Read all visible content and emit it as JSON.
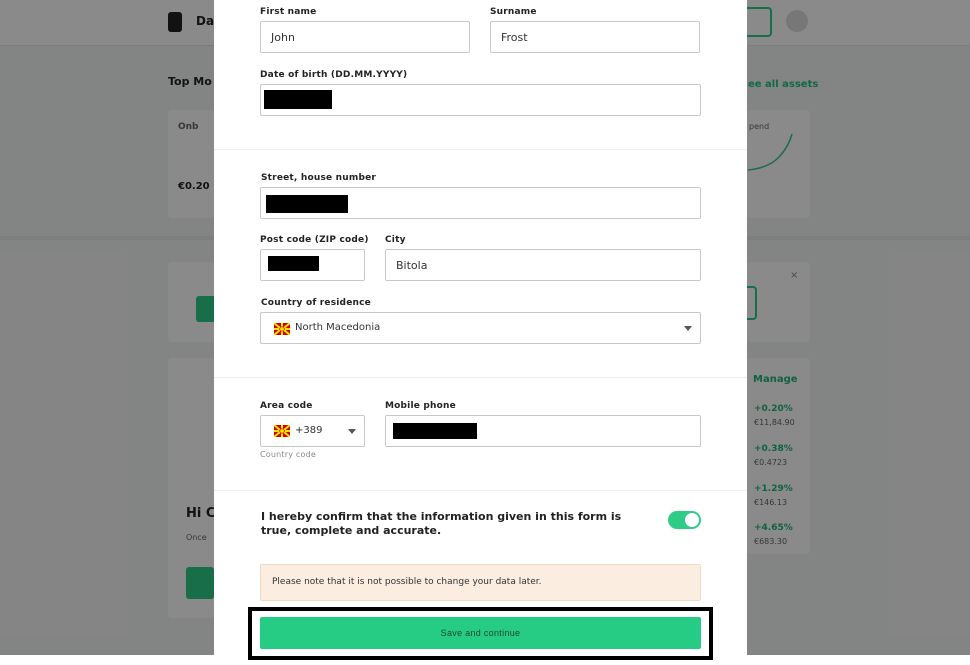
{
  "background": {
    "nav_text": "Das",
    "section_title": "Top Mo",
    "see_all_link": "ee all assets",
    "card_value": "€0.20",
    "card_label": "Onb",
    "spend_label": "pend",
    "manage_label": "Manage",
    "greeting": "Hi C",
    "greeting_sub": "Once",
    "movers": [
      {
        "change": "+0.20%",
        "price": "€11,84.90"
      },
      {
        "change": "+0.38%",
        "price": "€0.4723"
      },
      {
        "change": "+1.29%",
        "price": "€146.13"
      },
      {
        "change": "+4.65%",
        "price": "€683.30"
      }
    ]
  },
  "form": {
    "first_name": {
      "label": "First name",
      "value": "John"
    },
    "surname": {
      "label": "Surname",
      "value": "Frost"
    },
    "dob": {
      "label": "Date of birth (DD.MM.YYYY)"
    },
    "street": {
      "label": "Street, house number"
    },
    "postcode": {
      "label": "Post code (ZIP code)"
    },
    "city": {
      "label": "City",
      "value": "Bitola"
    },
    "country": {
      "label": "Country of residence",
      "value": "North Macedonia",
      "flag": "north-macedonia-flag"
    },
    "area_code": {
      "label": "Area code",
      "value": "+389",
      "hint": "Country code",
      "flag": "north-macedonia-flag"
    },
    "mobile": {
      "label": "Mobile phone"
    },
    "confirm": {
      "text": "I hereby confirm that the information given in this form is true, complete and accurate.",
      "checked": true
    },
    "notice": "Please note that it is not possible to change your data later.",
    "submit_label": "Save and continue"
  },
  "colors": {
    "accent": "#27cc84",
    "notice_bg": "#fbede0",
    "redaction": "#000000"
  }
}
